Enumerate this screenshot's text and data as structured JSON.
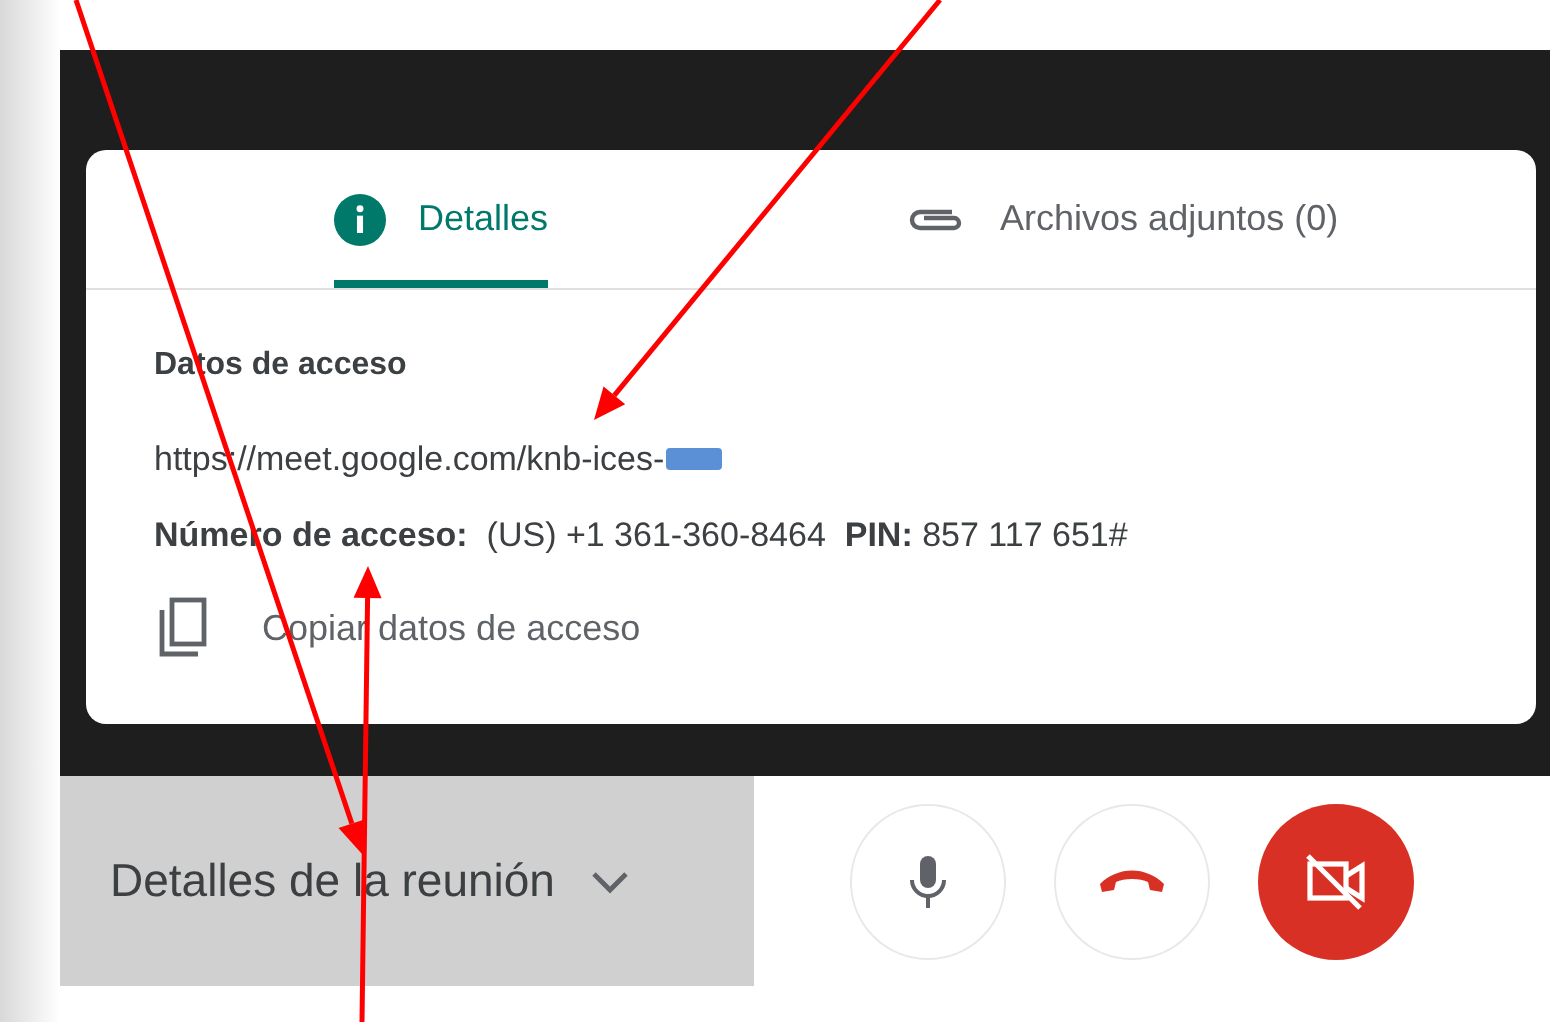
{
  "tabs": [
    {
      "label": "Detalles",
      "selected": true,
      "kind": "info"
    },
    {
      "label": "Archivos adjuntos (0)",
      "selected": false,
      "kind": "attachment"
    }
  ],
  "access": {
    "heading": "Datos de acceso",
    "url": "https://meet.google.com/knb-ices-",
    "dial_in": "**Número de acceso:**  (US) +1 361-360-8464  **PIN:** 857 117 651#",
    "copy_label": "Copiar datos de acceso"
  },
  "meeting_details": {
    "label": "Detalles de la reunión",
    "expanded": false
  },
  "controls": [
    {
      "kind": "mic"
    },
    {
      "kind": "hangup"
    },
    {
      "kind": "camera",
      "on": false
    }
  ]
}
